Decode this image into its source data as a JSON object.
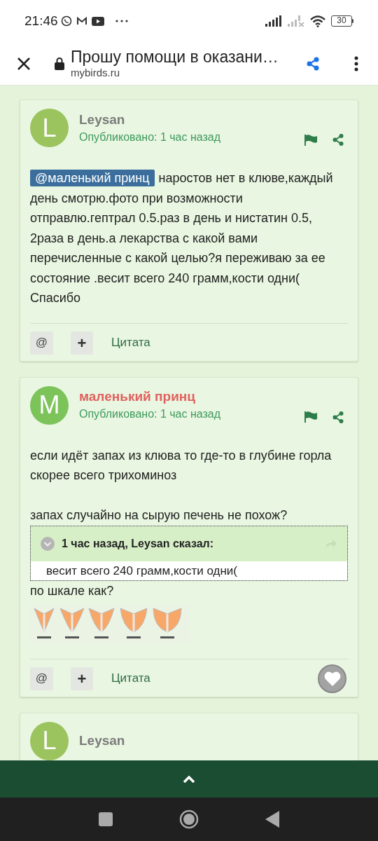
{
  "status_bar": {
    "time": "21:46",
    "battery": "30"
  },
  "header": {
    "title": "Прошу помощи в оказани…",
    "url": "mybirds.ru"
  },
  "posts": [
    {
      "avatar": {
        "letter": "L",
        "color": "#9bc45f"
      },
      "author": {
        "name": "Leysan",
        "color": "#7b7b7b"
      },
      "published": "Опубликовано: 1 час назад",
      "blocks": [
        {
          "kind": "text",
          "mention": "@маленький принц",
          "lines": [
            "наростов нет в клюве,каждый день смотрю.фото при возможности отправлю.гептрал 0.5.раз в день и нистатин 0.5, 2раза в день.а лекарства с какой вами перечисленные с какой целью?я переживаю за ее состояние .весит всего 240 грамм,кости одни(",
            "Спасибо"
          ]
        }
      ],
      "actions": {
        "mention": "@",
        "add": "+",
        "quote": "Цитата"
      },
      "like_button": false
    },
    {
      "avatar": {
        "letter": "M",
        "color": "#7cc35a"
      },
      "author": {
        "name": "маленький принц",
        "color": "#e0615f"
      },
      "published": "Опубликовано: 1 час назад",
      "blocks": [
        {
          "kind": "text",
          "lines": [
            "если идёт запах из клюва то где-то в глубине горла скорее всего трихоминоз"
          ]
        },
        {
          "kind": "text",
          "lines": [
            "запах случайно на сырую печень не похож?"
          ]
        },
        {
          "kind": "quote",
          "header": "1 час назад, Leysan сказал:",
          "text": "весит всего 240 грамм,кости одни("
        },
        {
          "kind": "text",
          "lines": [
            "по шкале как?"
          ]
        },
        {
          "kind": "picture"
        }
      ],
      "actions": {
        "mention": "@",
        "add": "+",
        "quote": "Цитата"
      },
      "like_button": true
    },
    {
      "avatar": {
        "letter": "L",
        "color": "#9bc45f"
      },
      "author": {
        "name": "Leysan",
        "color": "#7b7b7b"
      }
    }
  ]
}
